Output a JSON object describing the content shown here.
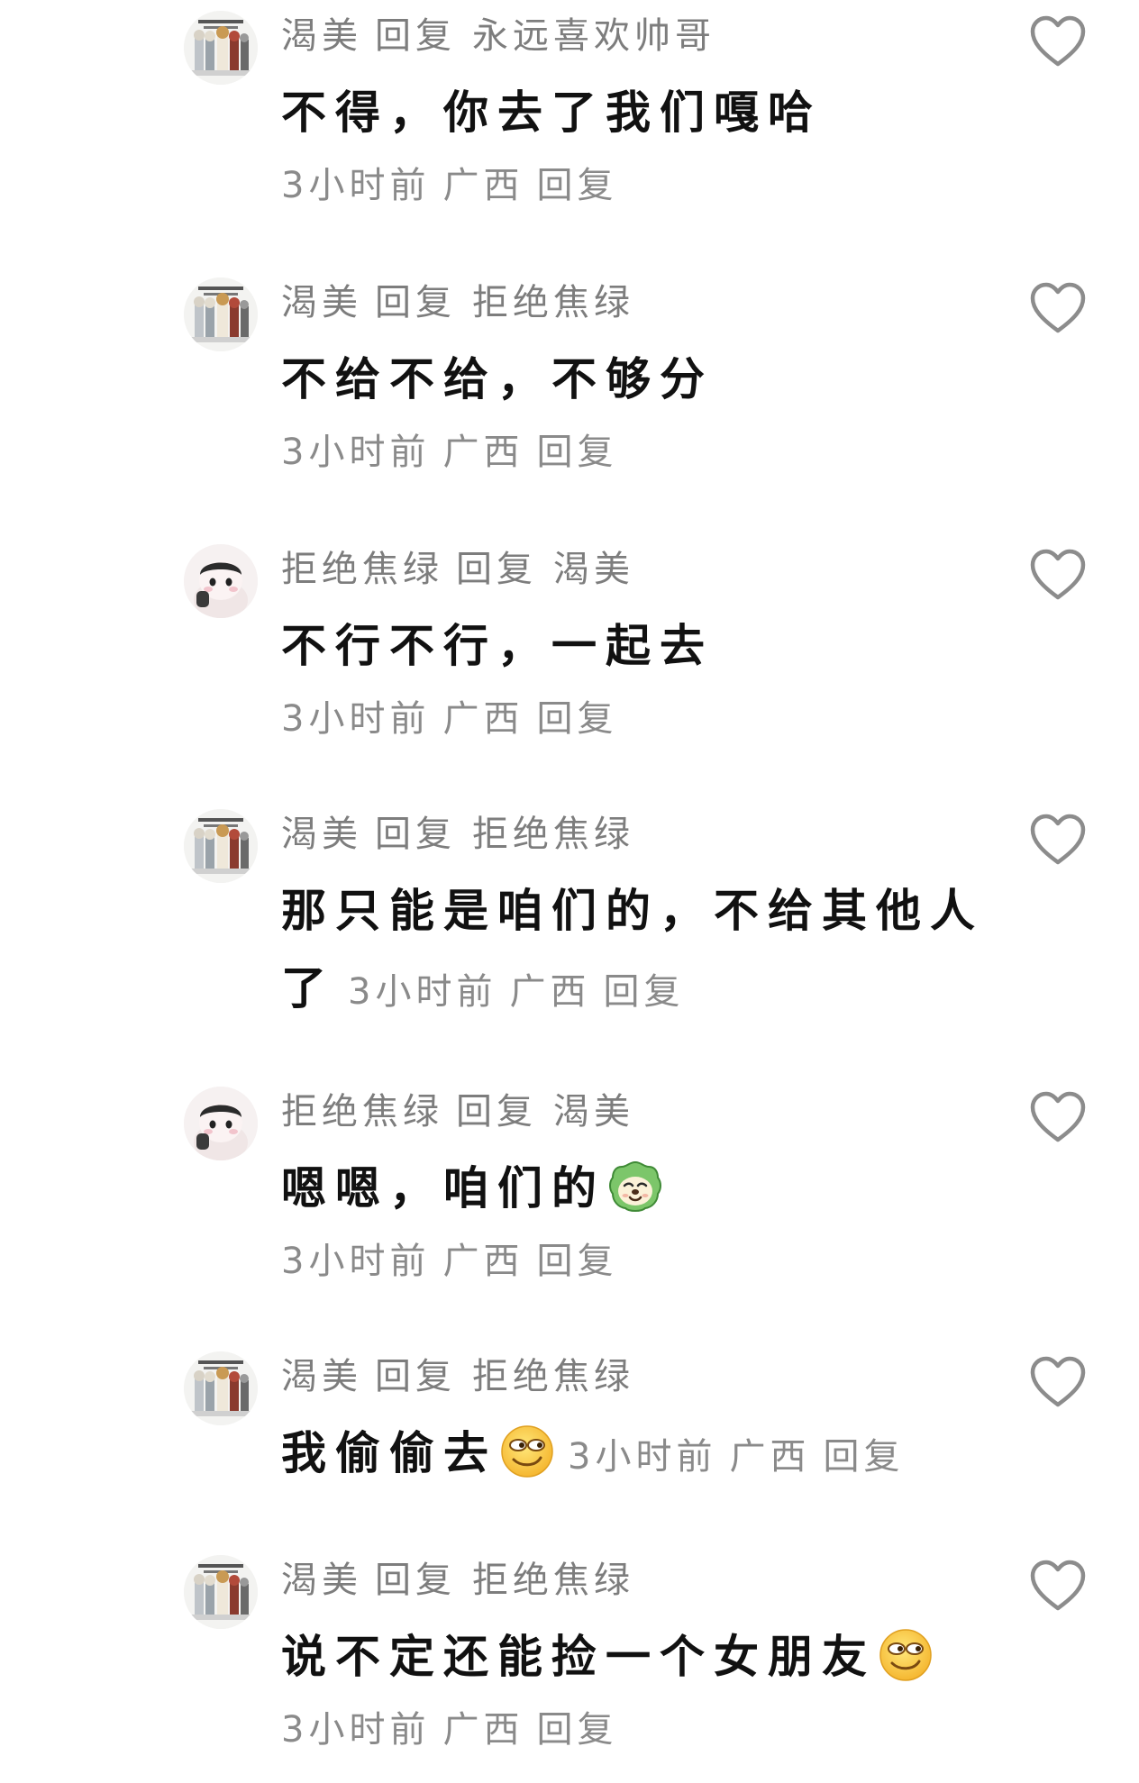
{
  "comments": [
    {
      "author": "渴美",
      "reply_word": "回复",
      "target": "永远喜欢帅哥",
      "text": "不得，你去了我们嘎哈",
      "time": "3小时前",
      "location": "广西",
      "reply_action": "回复",
      "avatar": "comic-group-avatar",
      "emoji": ""
    },
    {
      "author": "渴美",
      "reply_word": "回复",
      "target": "拒绝焦绿",
      "text": "不给不给，不够分",
      "time": "3小时前",
      "location": "广西",
      "reply_action": "回复",
      "avatar": "comic-group-avatar",
      "emoji": ""
    },
    {
      "author": "拒绝焦绿",
      "reply_word": "回复",
      "target": "渴美",
      "text": "不行不行，一起去",
      "time": "3小时前",
      "location": "广西",
      "reply_action": "回复",
      "avatar": "plush-doll-avatar",
      "emoji": ""
    },
    {
      "author": "渴美",
      "reply_word": "回复",
      "target": "拒绝焦绿",
      "text": "那只能是咱们的，不给其他人了",
      "time": "3小时前",
      "location": "广西",
      "reply_action": "回复",
      "avatar": "comic-group-avatar",
      "emoji": ""
    },
    {
      "author": "拒绝焦绿",
      "reply_word": "回复",
      "target": "渴美",
      "text": "嗯嗯，咱们的",
      "time": "3小时前",
      "location": "广西",
      "reply_action": "回复",
      "avatar": "plush-doll-avatar",
      "emoji": "green-dog-emoji"
    },
    {
      "author": "渴美",
      "reply_word": "回复",
      "target": "拒绝焦绿",
      "text": "我偷偷去",
      "time": "3小时前",
      "location": "广西",
      "reply_action": "回复",
      "avatar": "comic-group-avatar",
      "emoji": "sly-smile-emoji"
    },
    {
      "author": "渴美",
      "reply_word": "回复",
      "target": "拒绝焦绿",
      "text": "说不定还能捡一个女朋友",
      "time": "3小时前",
      "location": "广西",
      "reply_action": "回复",
      "avatar": "comic-group-avatar",
      "emoji": "sly-smile-emoji"
    }
  ],
  "icons": {
    "like": "heart-outline-icon"
  },
  "colors": {
    "author_text": "#7d7d7d",
    "body_text": "#111111",
    "meta_text": "#8a8a8a",
    "heart_stroke": "#8c8c8c"
  }
}
